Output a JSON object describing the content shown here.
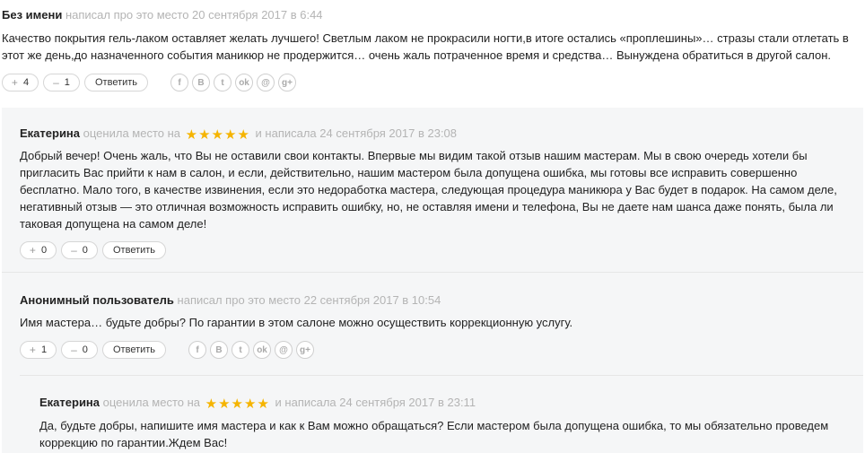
{
  "reviews": [
    {
      "author": "Без имени",
      "meta": "написал про это место 20 сентября 2017 в 6:44",
      "text": "Качество покрытия гель-лаком оставляет желать лучшего! Светлым лаком не прокрасили ногти,в итоге остались «проплешины»… стразы стали отлетать в этот же день,до назначенного события маникюр не продержится… очень жаль потраченное время и средства… Вынуждена обратиться в другой салон.",
      "plus": "4",
      "minus": "1",
      "reply": "Ответить",
      "shares": [
        "f",
        "B",
        "t",
        "ok",
        "mail",
        "g+"
      ]
    },
    {
      "author": "Екатерина",
      "meta_before": "оценила место на",
      "meta_after": "и написала 24 сентября 2017 в 23:08",
      "rating": 5,
      "text": "Добрый вечер! Очень жаль, что Вы не оставили свои контакты. Впервые мы видим такой отзыв нашим мастерам. Мы в свою очередь хотели бы пригласить Вас прийти к нам в салон, и если, действительно, нашим мастером была допущена ошибка, мы готовы все исправить совершенно бесплатно. Мало того, в качестве извинения, если это недоработка мастера, следующая процедура маникюра у Вас будет в подарок. На самом деле, негативный отзыв — это отличная возможность исправить ошибку, но, не оставляя имени и телефона, Вы не даете нам шанса даже понять, была ли таковая допущена на самом деле!",
      "plus": "0",
      "minus": "0",
      "reply": "Ответить"
    },
    {
      "author": "Анонимный пользователь",
      "meta": "написал про это место 22 сентября 2017 в 10:54",
      "text": "Имя мастера… будьте добры? По гарантии в этом салоне можно осуществить коррекционную услугу.",
      "plus": "1",
      "minus": "0",
      "reply": "Ответить",
      "shares": [
        "f",
        "B",
        "t",
        "ok",
        "mail",
        "g+"
      ]
    },
    {
      "author": "Екатерина",
      "meta_before": "оценила место на",
      "meta_after": "и написала 24 сентября 2017 в 23:11",
      "rating": 5,
      "text": "Да, будьте добры, напишите имя мастера и как к Вам можно обращаться? Если мастером была допущена ошибка, то мы обязательно проведем коррекцию по гарантии.Ждем Вас!"
    }
  ],
  "icons": {
    "plus": "+",
    "minus": "–",
    "star": "★",
    "star_color": "#f5b400"
  }
}
